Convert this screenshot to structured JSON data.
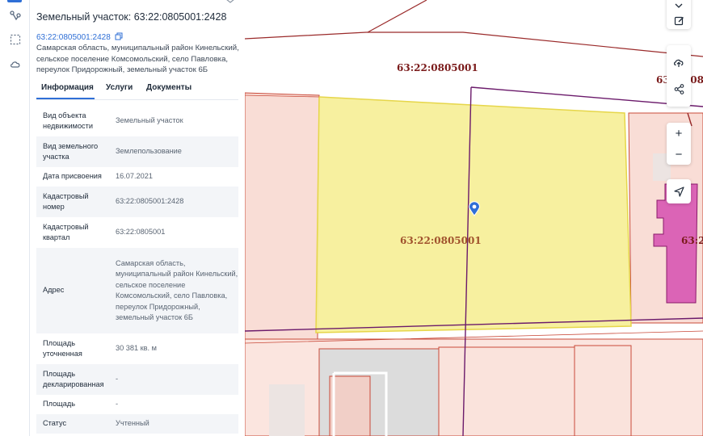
{
  "rail": {
    "icons": [
      "list-icon",
      "route-icon",
      "select-area-icon",
      "cloud-icon"
    ]
  },
  "panel": {
    "title": "Земельный участок: 63:22:0805001:2428",
    "cad_number_link": "63:22:0805001:2428",
    "address": "Самарская область, муниципальный район Кинельский, сельское поселение Комсомольский, село Павловка, переулок Придорожный, земельный участок 6Б",
    "tabs": [
      {
        "label": "Информация",
        "active": true
      },
      {
        "label": "Услуги",
        "active": false
      },
      {
        "label": "Документы",
        "active": false
      }
    ],
    "properties": [
      {
        "key": "Вид объекта недвижимости",
        "value": "Земельный участок"
      },
      {
        "key": "Вид земельного участка",
        "value": "Землепользование"
      },
      {
        "key": "Дата присвоения",
        "value": "16.07.2021"
      },
      {
        "key": "Кадастровый номер",
        "value": "63:22:0805001:2428"
      },
      {
        "key": "Кадастровый квартал",
        "value": "63:22:0805001"
      },
      {
        "key": "Адрес",
        "value": "Самарская область, муниципальный район Кинельский, сельское поселение Комсомольский, село Павловка, переулок Придорожный, земельный участок 6Б"
      },
      {
        "key": "Площадь уточненная",
        "value": "30 381 кв. м"
      },
      {
        "key": "Площадь декларированная",
        "value": "-"
      },
      {
        "key": "Площадь",
        "value": "-"
      },
      {
        "key": "Статус",
        "value": "Учтенный"
      }
    ]
  },
  "map": {
    "labels": {
      "quarter_top": "63:22:0805001",
      "quarter_right": "63:22:0805001",
      "parcel": "63:22:0805001",
      "edge_right": "63:2"
    },
    "colors": {
      "selected_fill": "#f7ef9a",
      "selected_stroke": "#e6d64a",
      "parcel_fill": "#f9ddd6",
      "parcel_stroke": "#c94a3a",
      "quarter_line": "#6b1a6b",
      "pin": "#2f6fd6",
      "building": "#d64fb0",
      "label_dark": "#7a1a1a",
      "label_parcel": "#a0522d"
    },
    "controls": [
      "favorite-icon",
      "edit-icon",
      "upload-icon",
      "share-icon",
      "zoom-in",
      "zoom-out",
      "locate-icon"
    ],
    "zoom_in_label": "+",
    "zoom_out_label": "−"
  }
}
